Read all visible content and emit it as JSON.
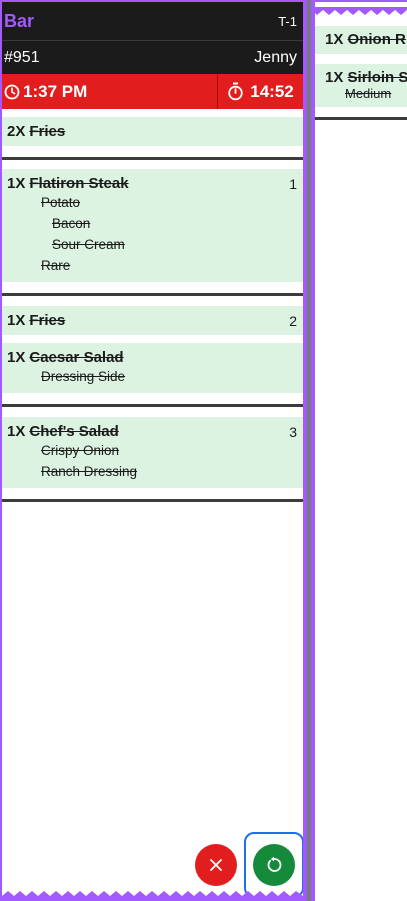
{
  "ticket": {
    "station": "Bar",
    "table": "T-1",
    "order_number": "#951",
    "server": "Jenny",
    "order_time": "1:37 PM",
    "elapsed": "14:52",
    "colors": {
      "accent": "#a259ff",
      "header": "#1b1b1b",
      "alert": "#e11d1d",
      "item_bg": "#dcf3e2",
      "confirm": "#158a3a"
    },
    "items": [
      {
        "qty": "2X",
        "name": "Fries",
        "name_struck": false,
        "seat": "",
        "mods": []
      },
      {
        "qty": "1X",
        "name": "Flatiron Steak",
        "name_struck": true,
        "seat": "1",
        "mods": [
          {
            "text": "Potato",
            "level": 1
          },
          {
            "text": "Bacon",
            "level": 2
          },
          {
            "text": "Sour Cream",
            "level": 2
          },
          {
            "text": "Rare",
            "level": 1
          }
        ]
      },
      {
        "qty": "1X",
        "name": "Fries",
        "name_struck": false,
        "seat": "2",
        "mods": []
      },
      {
        "qty": "1X",
        "name": "Caesar Salad",
        "name_struck": true,
        "seat": "",
        "mods": [
          {
            "text": "Dressing Side",
            "level": 1
          }
        ]
      },
      {
        "qty": "1X",
        "name": "Chef's Salad",
        "name_struck": true,
        "seat": "3",
        "mods": [
          {
            "text": "Crispy Onion",
            "level": 1
          },
          {
            "text": "Ranch Dressing",
            "level": 1
          }
        ]
      }
    ],
    "icons": {
      "clock": "clock-icon",
      "timer": "timer-icon",
      "cancel": "close-icon",
      "restore": "restore-icon"
    }
  },
  "ticket2": {
    "items": [
      {
        "qty": "1X",
        "name": "Onion R"
      },
      {
        "qty": "1X",
        "name": "Sirloin S",
        "mod": "Medium"
      }
    ]
  }
}
